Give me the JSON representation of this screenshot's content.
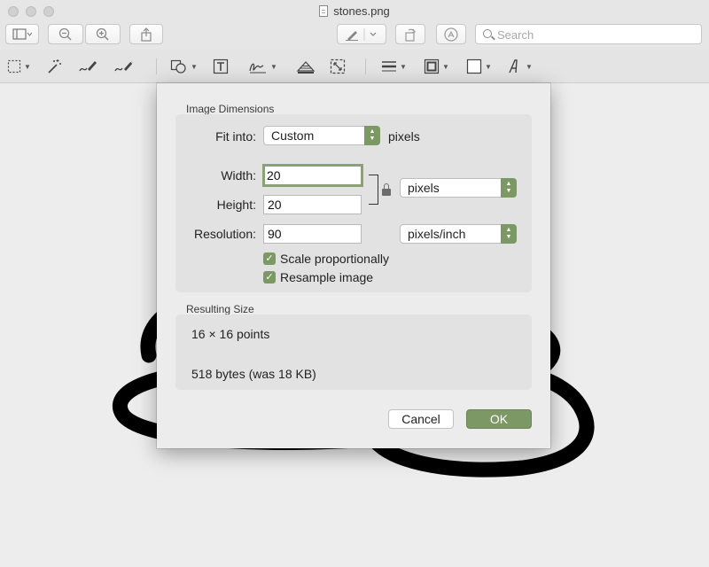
{
  "window": {
    "title": "stones.png"
  },
  "toolbar": {
    "search_placeholder": "Search"
  },
  "dialog": {
    "image_dimensions_title": "Image Dimensions",
    "fit_into": {
      "label": "Fit into:",
      "value": "Custom",
      "unit": "pixels"
    },
    "width": {
      "label": "Width:",
      "value": "20"
    },
    "height": {
      "label": "Height:",
      "value": "20"
    },
    "size_unit": "pixels",
    "resolution": {
      "label": "Resolution:",
      "value": "90",
      "unit": "pixels/inch"
    },
    "scale_proportionally": {
      "label": "Scale proportionally",
      "checked": true
    },
    "resample_image": {
      "label": "Resample image",
      "checked": true
    },
    "resulting_size_title": "Resulting Size",
    "result_points": "16 × 16 points",
    "result_bytes": "518 bytes (was 18 KB)",
    "cancel_label": "Cancel",
    "ok_label": "OK"
  },
  "colors": {
    "accent": "#7c9865",
    "stroke": "#000000"
  }
}
